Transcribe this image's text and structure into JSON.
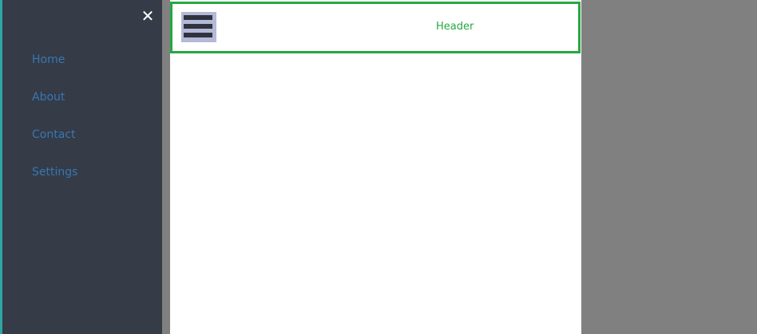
{
  "sidebar": {
    "close_glyph": "✕",
    "close_icon": "close-icon",
    "items": [
      {
        "label": "Home"
      },
      {
        "label": "About"
      },
      {
        "label": "Contact"
      },
      {
        "label": "Settings"
      }
    ]
  },
  "header": {
    "title": "Header",
    "menu_icon": "hamburger-icon"
  },
  "colors": {
    "sidebar_bg": "#353b47",
    "sidebar_accent": "#2fa4a3",
    "nav_link": "#3777b3",
    "header_border": "#26a843",
    "header_text": "#26a843",
    "hamburger_bg": "#b3b9d6",
    "hamburger_bar": "#30333f",
    "backdrop": "#808080"
  }
}
